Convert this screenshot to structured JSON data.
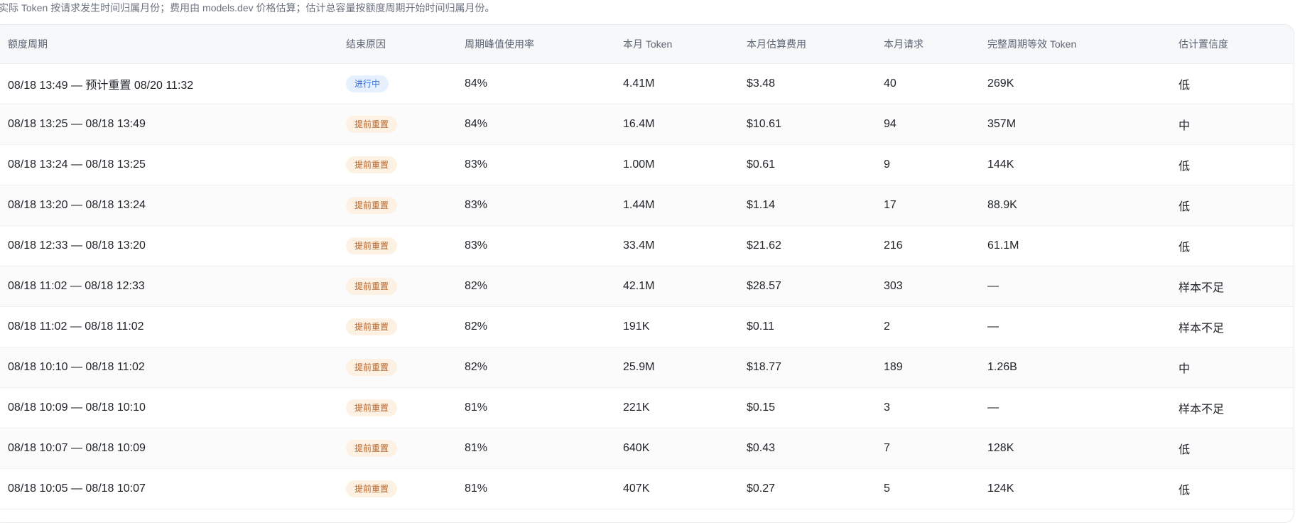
{
  "note": "实际 Token 按请求发生时间归属月份；费用由 models.dev 价格估算；估计总容量按额度周期开始时间归属月份。",
  "table": {
    "headers": [
      "额度周期",
      "结束原因",
      "周期峰值使用率",
      "本月 Token",
      "本月估算费用",
      "本月请求",
      "完整周期等效 Token",
      "估计置信度"
    ],
    "rows": [
      {
        "period": "08/18 13:49 — 预计重置 08/20 11:32",
        "reason": "进行中",
        "reason_type": "active",
        "peak": "84%",
        "tokens": "4.41M",
        "cost": "$3.48",
        "requests": "40",
        "equiv": "269K",
        "confidence": "低"
      },
      {
        "period": "08/18 13:25 — 08/18 13:49",
        "reason": "提前重置",
        "reason_type": "early",
        "peak": "84%",
        "tokens": "16.4M",
        "cost": "$10.61",
        "requests": "94",
        "equiv": "357M",
        "confidence": "中"
      },
      {
        "period": "08/18 13:24 — 08/18 13:25",
        "reason": "提前重置",
        "reason_type": "early",
        "peak": "83%",
        "tokens": "1.00M",
        "cost": "$0.61",
        "requests": "9",
        "equiv": "144K",
        "confidence": "低"
      },
      {
        "period": "08/18 13:20 — 08/18 13:24",
        "reason": "提前重置",
        "reason_type": "early",
        "peak": "83%",
        "tokens": "1.44M",
        "cost": "$1.14",
        "requests": "17",
        "equiv": "88.9K",
        "confidence": "低"
      },
      {
        "period": "08/18 12:33 — 08/18 13:20",
        "reason": "提前重置",
        "reason_type": "early",
        "peak": "83%",
        "tokens": "33.4M",
        "cost": "$21.62",
        "requests": "216",
        "equiv": "61.1M",
        "confidence": "低"
      },
      {
        "period": "08/18 11:02 — 08/18 12:33",
        "reason": "提前重置",
        "reason_type": "early",
        "peak": "82%",
        "tokens": "42.1M",
        "cost": "$28.57",
        "requests": "303",
        "equiv": "—",
        "confidence": "样本不足"
      },
      {
        "period": "08/18 11:02 — 08/18 11:02",
        "reason": "提前重置",
        "reason_type": "early",
        "peak": "82%",
        "tokens": "191K",
        "cost": "$0.11",
        "requests": "2",
        "equiv": "—",
        "confidence": "样本不足"
      },
      {
        "period": "08/18 10:10 — 08/18 11:02",
        "reason": "提前重置",
        "reason_type": "early",
        "peak": "82%",
        "tokens": "25.9M",
        "cost": "$18.77",
        "requests": "189",
        "equiv": "1.26B",
        "confidence": "中"
      },
      {
        "period": "08/18 10:09 — 08/18 10:10",
        "reason": "提前重置",
        "reason_type": "early",
        "peak": "81%",
        "tokens": "221K",
        "cost": "$0.15",
        "requests": "3",
        "equiv": "—",
        "confidence": "样本不足"
      },
      {
        "period": "08/18 10:07 — 08/18 10:09",
        "reason": "提前重置",
        "reason_type": "early",
        "peak": "81%",
        "tokens": "640K",
        "cost": "$0.43",
        "requests": "7",
        "equiv": "128K",
        "confidence": "低"
      },
      {
        "period": "08/18 10:05 — 08/18 10:07",
        "reason": "提前重置",
        "reason_type": "early",
        "peak": "81%",
        "tokens": "407K",
        "cost": "$0.27",
        "requests": "5",
        "equiv": "124K",
        "confidence": "低"
      }
    ]
  }
}
